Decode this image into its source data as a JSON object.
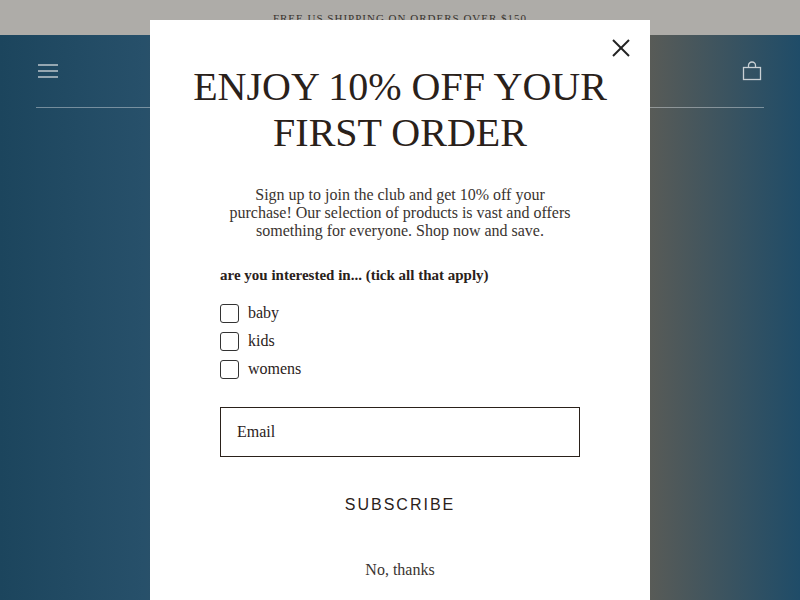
{
  "announcement": "FREE US SHIPPING ON ORDERS OVER $150",
  "popup": {
    "title": "ENJOY 10% OFF YOUR FIRST ORDER",
    "description": "Sign up to join the club and get 10% off your purchase! Our selection of products is vast and offers something for everyone. Shop now and save.",
    "interests_label": "are you interested in... (tick all that apply)",
    "interests": [
      {
        "label": "baby",
        "checked": false
      },
      {
        "label": "kids",
        "checked": false
      },
      {
        "label": "womens",
        "checked": false
      }
    ],
    "email": {
      "placeholder": "Email"
    },
    "submit": "SUBSCRIBE",
    "dismiss": "No, thanks"
  }
}
